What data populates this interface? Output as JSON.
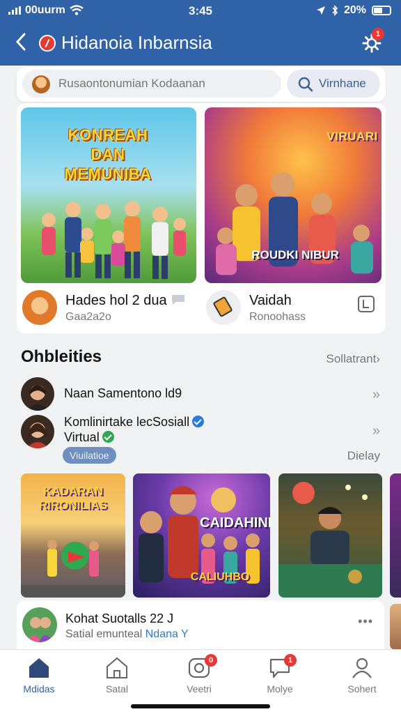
{
  "status": {
    "carrier": "00uurm",
    "time": "3:45",
    "battery": "20%"
  },
  "header": {
    "title": "Hidanoia Inbarnsia",
    "notif_count": "1"
  },
  "search": {
    "placeholder": "Rusaontonumian Kodaanan",
    "button_label": "Virnhane"
  },
  "featured": [
    {
      "poster_title": "KONREAH DAN MEMUNIBA",
      "title": "Hades hol 2 dua",
      "subtitle": "Gaa2a2o"
    },
    {
      "poster_title": "VIRUARI",
      "poster_caption": "ROUDKI NIBUR",
      "title": "Vaidah",
      "subtitle": "Ronoohass"
    }
  ],
  "section": {
    "title": "Ohbleities",
    "link": "Sollatrant"
  },
  "users": [
    {
      "text": "Naan Samentono ld9"
    },
    {
      "text": "Komlinirtake lecSosiall",
      "line2": "Virtual",
      "pill": "Viuilatioe"
    }
  ],
  "side_label": "Dielay",
  "videos": [
    {
      "title": "KADARAN RIRONILIAS"
    },
    {
      "title": "CAIDAHINI",
      "caption": "CALIUHBO"
    },
    {
      "title": ""
    }
  ],
  "post": {
    "title": "Kohat Suotalls 22 J",
    "subtitle": "Satial emunteal",
    "highlight": "Ndana Y"
  },
  "nav": [
    {
      "label": "Mdidas",
      "active": true
    },
    {
      "label": "Satal"
    },
    {
      "label": "Veetri",
      "badge": "0"
    },
    {
      "label": "Molye",
      "badge": "1"
    },
    {
      "label": "Sohert"
    }
  ],
  "colors": {
    "primary": "#2f62a6",
    "badge": "#e53935",
    "verified_blue": "#2b7bd6",
    "verified_green": "#2fa84f"
  }
}
